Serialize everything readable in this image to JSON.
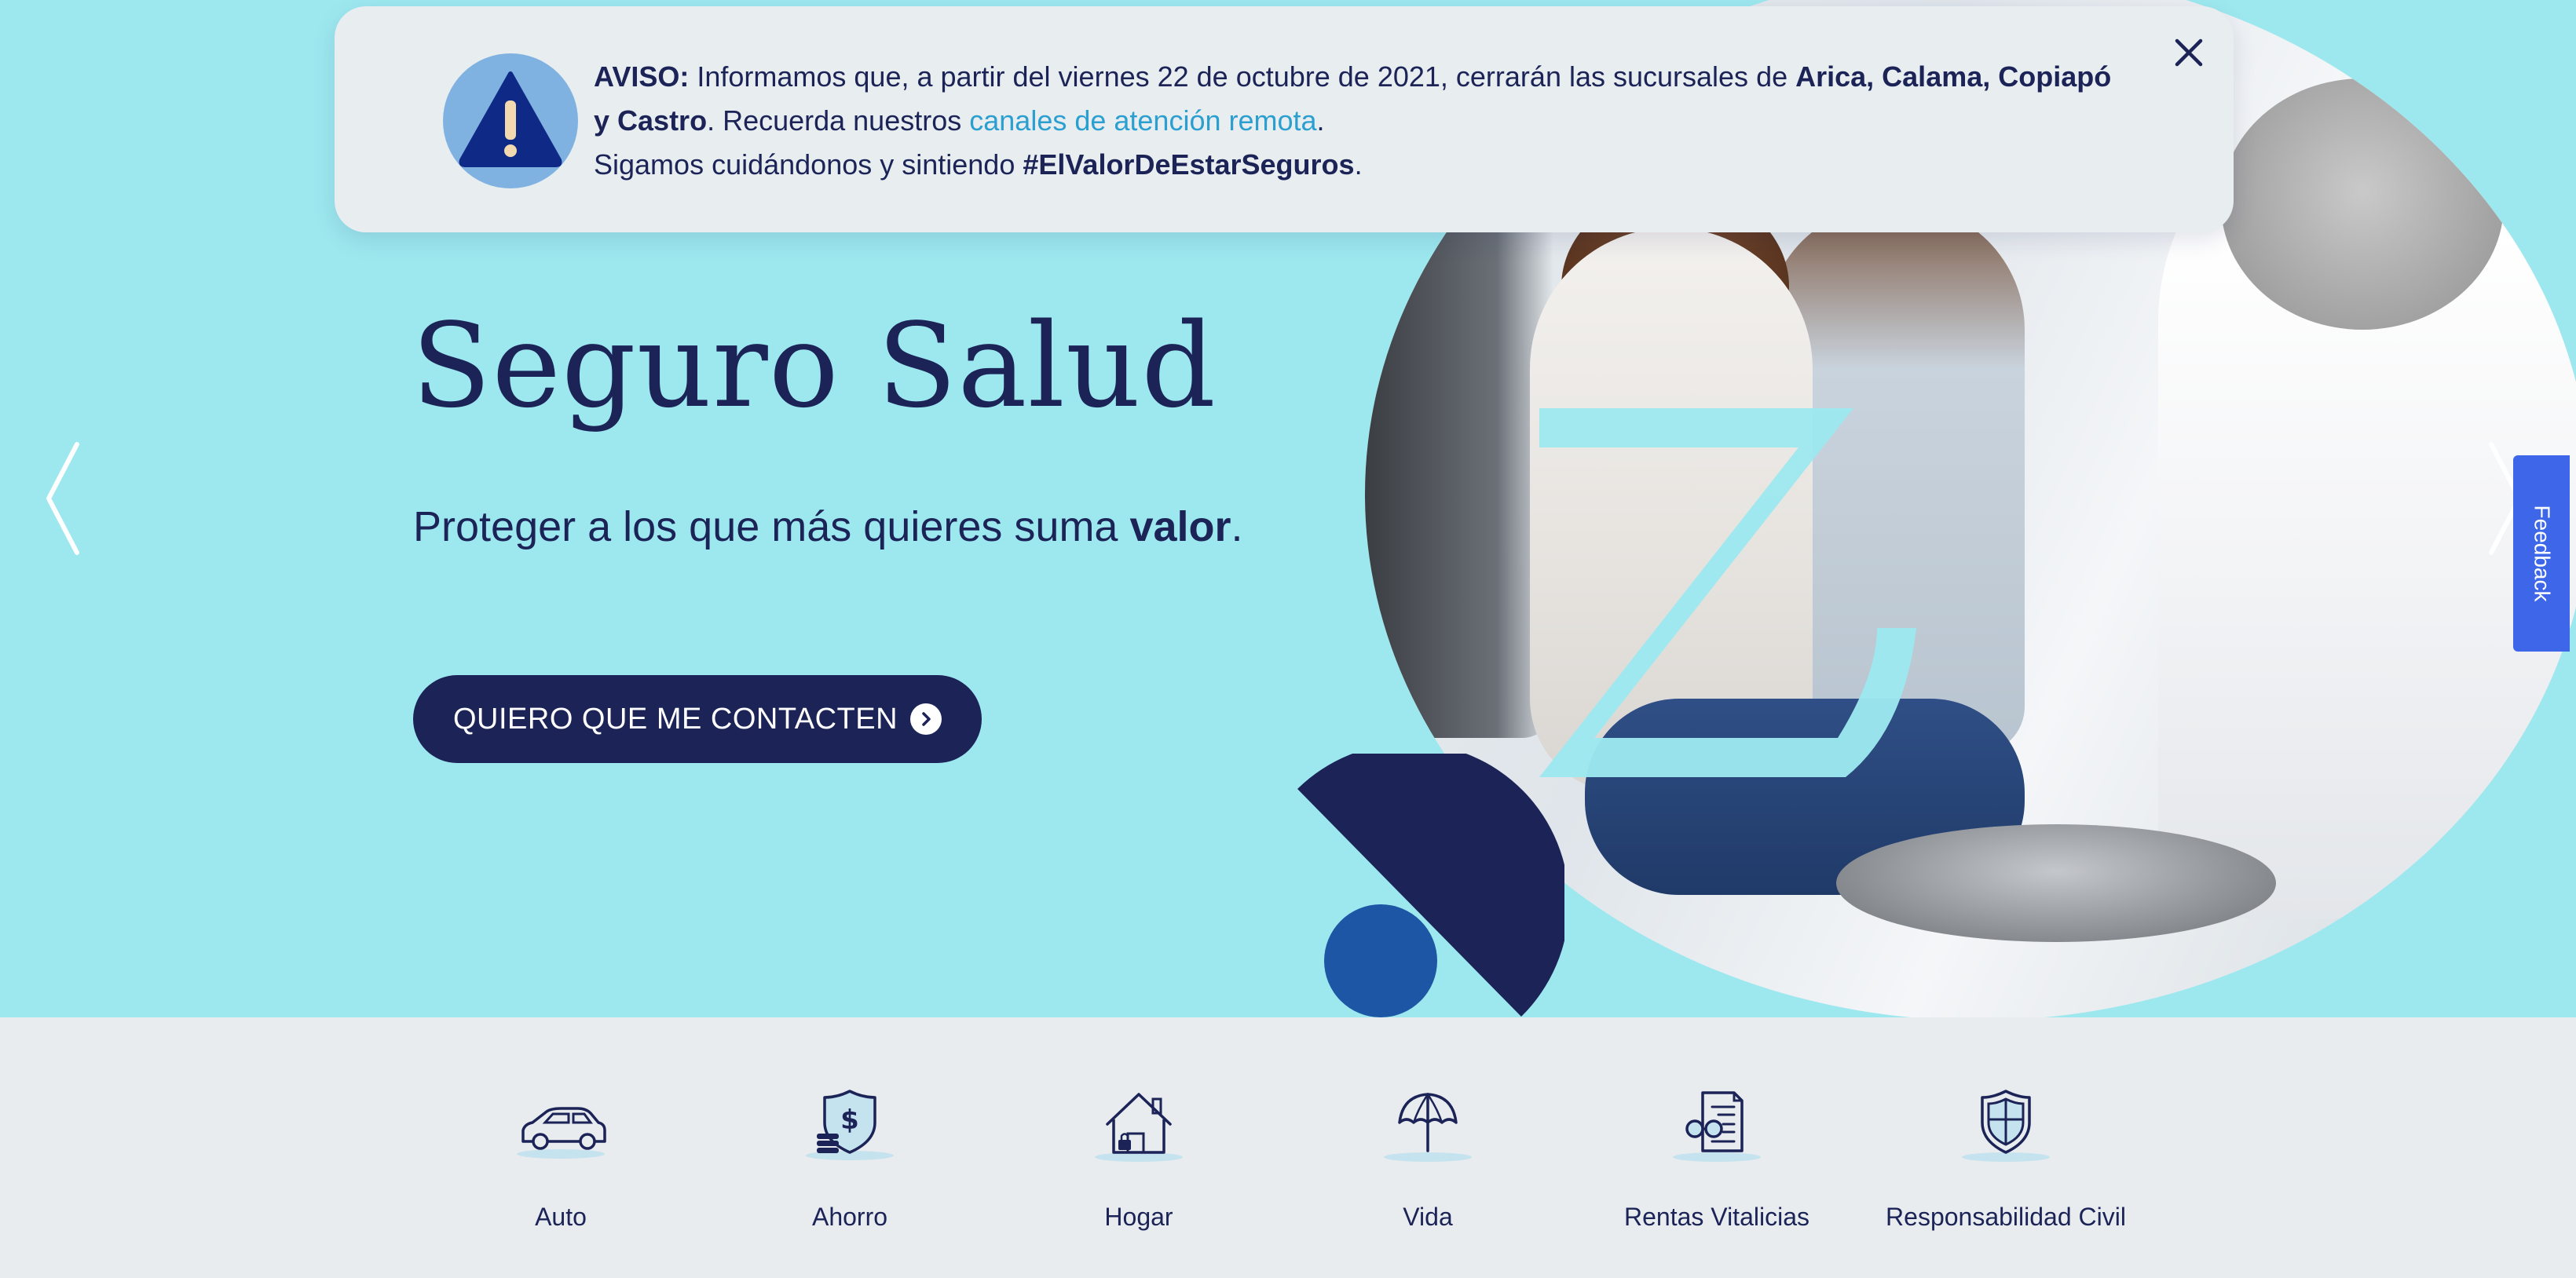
{
  "notice": {
    "label": "AVISO:",
    "text_1": " Informamos que, a partir del viernes 22 de octubre de 2021, cerrarán las sucursales de ",
    "branches": "Arica, Calama, Copiapó y Castro",
    "text_2": ". Recuerda nuestros ",
    "link": "canales de atención remota",
    "text_3": ".",
    "line_2": "Sigamos cuidándonos y sintiendo ",
    "hashtag": "#ElValorDeEstarSeguros",
    "line_2_end": "."
  },
  "hero": {
    "title": "Seguro Salud",
    "subtitle_text": "Proteger a los que más quieres suma ",
    "subtitle_bold": "valor",
    "subtitle_end": ".",
    "cta_label": "QUIERO QUE ME CONTACTEN"
  },
  "feedback": {
    "label": "Feedback"
  },
  "categories": [
    {
      "label": "Auto",
      "icon": "car-icon"
    },
    {
      "label": "Ahorro",
      "icon": "savings-shield-icon"
    },
    {
      "label": "Hogar",
      "icon": "house-icon"
    },
    {
      "label": "Vida",
      "icon": "umbrella-icon"
    },
    {
      "label": "Rentas Vitalicias",
      "icon": "document-glasses-icon"
    },
    {
      "label": "Responsabilidad Civil",
      "icon": "shield-icon"
    }
  ],
  "colors": {
    "hero_background": "#9de8ef",
    "navy": "#1b2357",
    "link_blue": "#2a9fd0",
    "feedback_blue": "#3d67e8",
    "category_background": "#e8ecef"
  }
}
